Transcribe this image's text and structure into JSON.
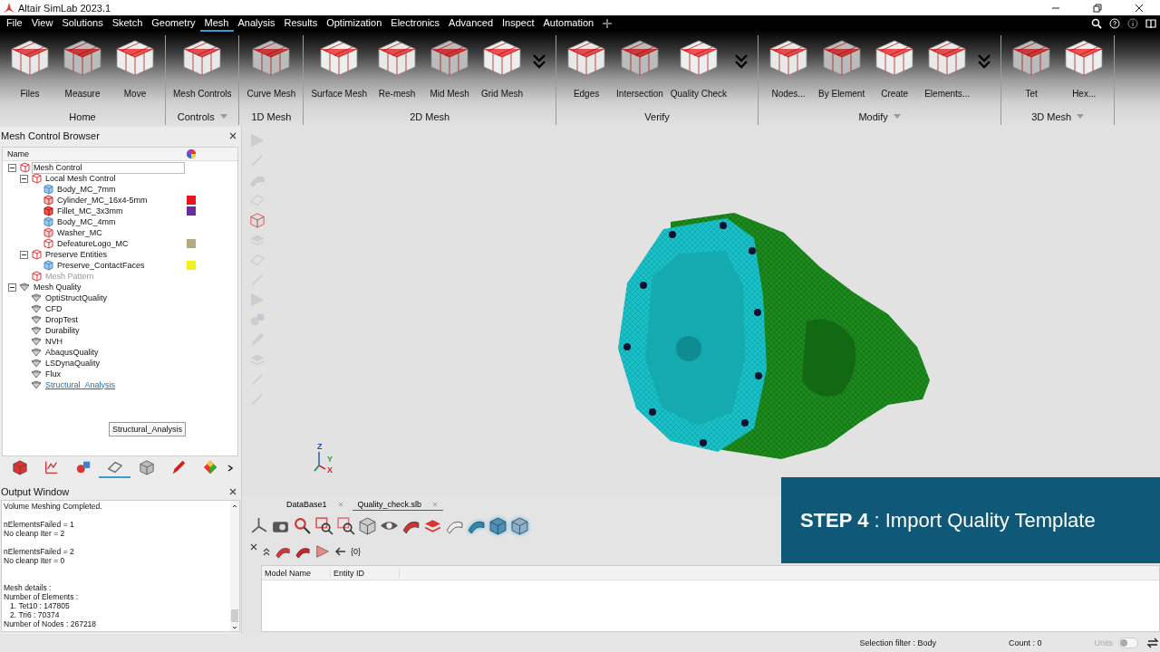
{
  "window": {
    "title": "Altair SimLab 2023.1"
  },
  "menu": [
    {
      "label": "File",
      "selected": false
    },
    {
      "label": "View",
      "selected": false
    },
    {
      "label": "Solutions",
      "selected": false
    },
    {
      "label": "Sketch",
      "selected": false
    },
    {
      "label": "Geometry",
      "selected": false
    },
    {
      "label": "Mesh",
      "selected": true
    },
    {
      "label": "Analysis",
      "selected": false
    },
    {
      "label": "Results",
      "selected": false
    },
    {
      "label": "Optimization",
      "selected": false
    },
    {
      "label": "Electronics",
      "selected": false
    },
    {
      "label": "Advanced",
      "selected": false
    },
    {
      "label": "Inspect",
      "selected": false
    },
    {
      "label": "Automation",
      "selected": false
    }
  ],
  "ribbon": {
    "groups": [
      {
        "label": "Home",
        "has_dropdown": false,
        "more": false,
        "tools": [
          "Files",
          "Measure",
          "Move"
        ]
      },
      {
        "label": "Controls",
        "has_dropdown": true,
        "more": false,
        "tools": [
          "Mesh Controls"
        ]
      },
      {
        "label": "1D Mesh",
        "has_dropdown": false,
        "more": false,
        "tools": [
          "Curve Mesh"
        ]
      },
      {
        "label": "2D Mesh",
        "has_dropdown": false,
        "more": true,
        "tools": [
          "Surface Mesh",
          "Re-mesh",
          "Mid Mesh",
          "Grid Mesh"
        ]
      },
      {
        "label": "Verify",
        "has_dropdown": false,
        "more": true,
        "tools": [
          "Edges",
          "Intersection",
          "Quality Check"
        ]
      },
      {
        "label": "Modify",
        "has_dropdown": true,
        "more": true,
        "tools": [
          "Nodes...",
          "By Element",
          "Create",
          "Elements..."
        ]
      },
      {
        "label": "3D Mesh",
        "has_dropdown": true,
        "more": false,
        "tools": [
          "Tet",
          "Hex..."
        ]
      }
    ]
  },
  "mesh_browser": {
    "title": "Mesh Control Browser",
    "column": "Name",
    "tree": [
      {
        "label": "Mesh Control",
        "kind": "group",
        "expanded": true,
        "selected": true,
        "disabled": false,
        "hovered": false,
        "children": [
          {
            "label": "Local Mesh Control",
            "kind": "group",
            "expanded": true,
            "selected": false,
            "disabled": false,
            "hovered": false,
            "children": [
              {
                "label": "Body_MC_7mm",
                "kind": "body",
                "selected": false,
                "disabled": false,
                "hovered": false
              },
              {
                "label": "Cylinder_MC_16x4-5mm",
                "kind": "cylinder",
                "selected": false,
                "disabled": false,
                "hovered": false,
                "color": "#e8141c"
              },
              {
                "label": "Fillet_MC_3x3mm",
                "kind": "fillet",
                "selected": false,
                "disabled": false,
                "hovered": false,
                "color": "#6a2c9c"
              },
              {
                "label": "Body_MC_4mm",
                "kind": "body",
                "selected": false,
                "disabled": false,
                "hovered": false
              },
              {
                "label": "Washer_MC",
                "kind": "washer",
                "selected": false,
                "disabled": false,
                "hovered": false
              },
              {
                "label": "DefeatureLogo_MC",
                "kind": "group",
                "selected": false,
                "disabled": false,
                "hovered": false,
                "color": "#b5aa78"
              }
            ]
          },
          {
            "label": "Preserve Entities",
            "kind": "group",
            "expanded": true,
            "selected": false,
            "disabled": false,
            "hovered": false,
            "children": [
              {
                "label": "Preserve_ContactFaces",
                "kind": "body",
                "selected": false,
                "disabled": false,
                "hovered": false,
                "color": "#f2f01a"
              }
            ]
          },
          {
            "label": "Mesh Pattern",
            "kind": "group",
            "selected": false,
            "disabled": true,
            "hovered": false
          }
        ]
      },
      {
        "label": "Mesh Quality",
        "kind": "quality",
        "expanded": true,
        "selected": false,
        "disabled": false,
        "hovered": false,
        "children": [
          {
            "label": "OptiStructQuality",
            "kind": "quality",
            "selected": false,
            "disabled": false,
            "hovered": false
          },
          {
            "label": "CFD",
            "kind": "quality",
            "selected": false,
            "disabled": false,
            "hovered": false
          },
          {
            "label": "DropTest",
            "kind": "quality",
            "selected": false,
            "disabled": false,
            "hovered": false
          },
          {
            "label": "Durability",
            "kind": "quality",
            "selected": false,
            "disabled": false,
            "hovered": false
          },
          {
            "label": "NVH",
            "kind": "quality",
            "selected": false,
            "disabled": false,
            "hovered": false
          },
          {
            "label": "AbaqusQuality",
            "kind": "quality",
            "selected": false,
            "disabled": false,
            "hovered": false
          },
          {
            "label": "LSDynaQuality",
            "kind": "quality",
            "selected": false,
            "disabled": false,
            "hovered": false
          },
          {
            "label": "Flux",
            "kind": "quality",
            "selected": false,
            "disabled": false,
            "hovered": false
          },
          {
            "label": "Structural_Analysis",
            "kind": "quality",
            "selected": false,
            "disabled": false,
            "hovered": true
          }
        ]
      }
    ],
    "tooltip": "Structural_Analysis",
    "tabs": [
      {
        "selected": false
      },
      {
        "selected": false
      },
      {
        "selected": false
      },
      {
        "selected": true
      },
      {
        "selected": false
      },
      {
        "selected": false
      },
      {
        "selected": false
      }
    ]
  },
  "output": {
    "title": "Output Window",
    "blocks": [
      [
        "Volume Meshing Completed."
      ],
      [
        "nElementsFailed = 1",
        "No cleanp Iter = 2"
      ],
      [
        "nElementsFailed = 2",
        "No cleanp Iter = 0"
      ],
      [
        "Mesh details :",
        "Number of Elements :",
        "   1. Tet10 : 147805",
        "   2. Tri6 : 70374",
        "Number of Nodes : 267218"
      ]
    ]
  },
  "viewport": {
    "toolbar": [
      {
        "disabled": true
      },
      {
        "disabled": true
      },
      {
        "disabled": true
      },
      {
        "disabled": true
      },
      {
        "disabled": false
      },
      {
        "disabled": true
      },
      {
        "disabled": true
      },
      {
        "disabled": true
      },
      {
        "disabled": true
      },
      {
        "disabled": true
      },
      {
        "disabled": true
      },
      {
        "disabled": true
      },
      {
        "disabled": true
      },
      {
        "disabled": true
      }
    ],
    "axes": [
      "Z",
      "Y",
      "X"
    ]
  },
  "banner": {
    "text": "**STEP 4** : Import Quality Template"
  },
  "bottom": {
    "tabs": [
      {
        "label": "DataBase1",
        "selected": false
      },
      {
        "label": "Quality_check.slb",
        "selected": true
      }
    ],
    "toolbar": [
      {
        "on": false
      },
      {
        "on": false
      },
      {
        "on": false
      },
      {
        "on": false
      },
      {
        "on": false
      },
      {
        "on": false
      },
      {
        "on": false
      },
      {
        "on": false
      },
      {
        "on": false
      },
      {
        "on": false
      },
      {
        "on": true
      },
      {
        "on": true
      },
      {
        "on": true
      }
    ],
    "count": "{0}",
    "columns": [
      "Model Name",
      "Entity ID"
    ]
  },
  "status": {
    "selection_filter": "Selection filter : Body",
    "count": "Count : 0",
    "units": {
      "label": "Units",
      "on": false
    }
  }
}
